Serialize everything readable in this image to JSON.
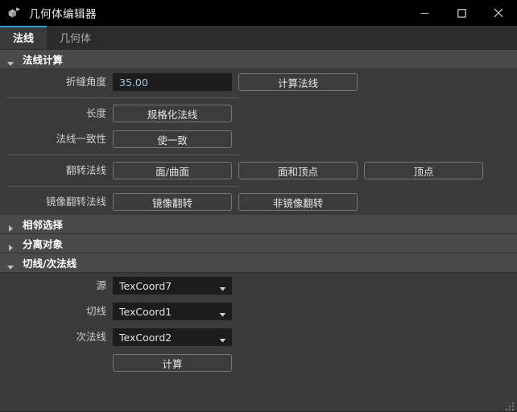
{
  "window": {
    "title": "几何体编辑器",
    "icon": "geometry-cube-icon",
    "minimize_label": "—",
    "maximize_label": "□",
    "close_label": "✕",
    "accent_color": "#2e9fd4",
    "background_color": "#3a3a3a",
    "titlebar_color": "#000000"
  },
  "tabs": [
    {
      "label": "法线",
      "active": true
    },
    {
      "label": "几何体",
      "active": false
    }
  ],
  "sections": [
    {
      "title": "法线计算",
      "expanded": true,
      "rows": [
        {
          "label": "折缝角度",
          "fields": [
            {
              "kind": "text",
              "value": "35.00"
            },
            {
              "kind": "button",
              "label": "计算法线"
            }
          ]
        },
        {
          "kind": "separator"
        },
        {
          "label": "长度",
          "fields": [
            {
              "kind": "button",
              "label": "规格化法线"
            }
          ]
        },
        {
          "label": "法线一致性",
          "fields": [
            {
              "kind": "button",
              "label": "使一致"
            }
          ]
        },
        {
          "kind": "separator"
        },
        {
          "label": "翻转法线",
          "fields": [
            {
              "kind": "button",
              "label": "面/曲面"
            },
            {
              "kind": "button",
              "label": "面和顶点"
            },
            {
              "kind": "button",
              "label": "顶点"
            }
          ]
        },
        {
          "kind": "separator"
        },
        {
          "label": "镜像翻转法线",
          "fields": [
            {
              "kind": "button",
              "label": "镜像翻转"
            },
            {
              "kind": "button",
              "label": "非镜像翻转"
            }
          ]
        }
      ]
    },
    {
      "title": "相邻选择",
      "expanded": false,
      "rows": []
    },
    {
      "title": "分离对象",
      "expanded": false,
      "rows": []
    },
    {
      "title": "切线/次法线",
      "expanded": true,
      "rows": [
        {
          "label": "源",
          "fields": [
            {
              "kind": "dropdown",
              "value": "TexCoord7"
            }
          ]
        },
        {
          "label": "切线",
          "fields": [
            {
              "kind": "dropdown",
              "value": "TexCoord1"
            }
          ]
        },
        {
          "label": "次法线",
          "fields": [
            {
              "kind": "dropdown",
              "value": "TexCoord2"
            }
          ]
        },
        {
          "label": "",
          "fields": [
            {
              "kind": "button",
              "label": "计算"
            }
          ]
        }
      ]
    }
  ],
  "resize_grip": "resize-grip"
}
